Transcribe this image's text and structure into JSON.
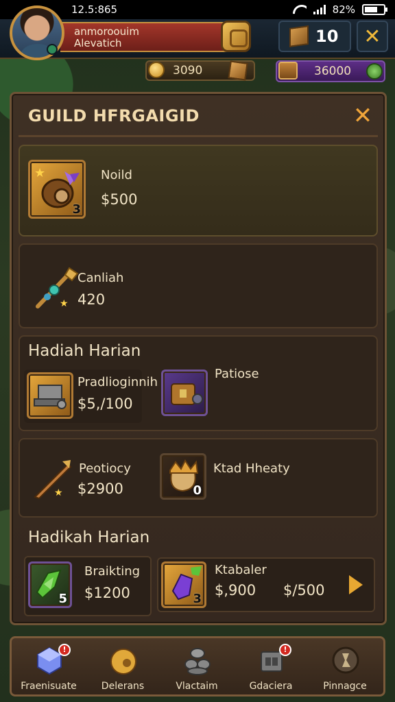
{
  "status_bar": {
    "time": "12.5:865",
    "battery_text": "82%"
  },
  "header": {
    "player_name": "anmoroouim",
    "player_subtitle": "Alevatich",
    "box_count": "10"
  },
  "currency": {
    "gold": "3090",
    "gems": "36000"
  },
  "panel": {
    "title": "GUILD HFRGAIGID",
    "featured": {
      "name": "Noild",
      "price": "$500",
      "count": "3"
    },
    "item2": {
      "name": "Canliah",
      "price": "420"
    },
    "section1": {
      "label": "Hadiah Harian",
      "items": [
        {
          "name": "Pradlioginnih",
          "price": "$5,/100"
        },
        {
          "name": "Patiose"
        }
      ]
    },
    "row3": {
      "items": [
        {
          "name": "Peotiocy",
          "price": "$2900"
        },
        {
          "name": "Ktad Hheaty",
          "count": "0"
        }
      ]
    },
    "section2": {
      "label": "Hadikah Harian",
      "items": [
        {
          "name": "Braikting",
          "price": "$1200",
          "count": "5"
        },
        {
          "name": "Ktabaler",
          "price": "$,900",
          "price_alt": "$/500",
          "count": "3"
        }
      ]
    }
  },
  "bottom_nav": {
    "items": [
      {
        "label": "Fraenisuate",
        "badge": "!"
      },
      {
        "label": "Delerans"
      },
      {
        "label": "Vlactaim"
      },
      {
        "label": "Gdaciera",
        "badge": "!"
      },
      {
        "label": "Pinnagce"
      }
    ]
  }
}
